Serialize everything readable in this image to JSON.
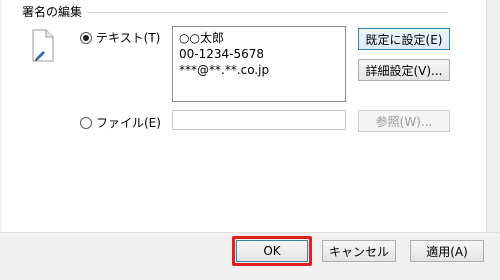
{
  "group": {
    "title": "署名の編集"
  },
  "text_option": {
    "label": "テキスト(T)",
    "checked": true
  },
  "text_content": "○○太郎\n00-1234-5678\n***@**.**.co.jp",
  "file_option": {
    "label": "ファイル(E)",
    "checked": false
  },
  "file_path": "",
  "buttons": {
    "set_default": "既定に設定(E)",
    "advanced": "詳細設定(V)...",
    "browse": "参照(W)...",
    "ok": "OK",
    "cancel": "キャンセル",
    "apply": "適用(A)"
  },
  "icons": {
    "document": "document-icon"
  },
  "colors": {
    "highlight_frame": "#e02020",
    "default_button_border": "#3c7fb1"
  }
}
